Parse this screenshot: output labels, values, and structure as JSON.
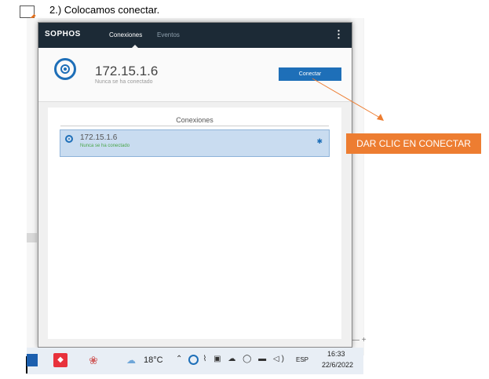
{
  "doc": {
    "step_text": "2.)  Colocamos conectar."
  },
  "sophos": {
    "logo": "SOPHOS",
    "tabs": [
      "Conexiones",
      "Eventos"
    ],
    "menu_icon": "kebab-menu-icon",
    "header_ip": "172.15.1.6",
    "header_status": "Nunca se ha conectado",
    "connect_button": "Conectar",
    "panel_title": "Conexiones",
    "connection": {
      "ip": "172.15.1.6",
      "status": "Nunca se ha conectado",
      "gear_icon": "gear-icon"
    },
    "accent": "#1e6fb8",
    "topbar_color": "#1c2a36"
  },
  "annotation": {
    "label": "DAR CLIC EN CONECTAR",
    "color": "#ed7d31"
  },
  "taskbar": {
    "temperature": "18°C",
    "language": "ESP",
    "time": "16:33",
    "date": "22/6/2022"
  }
}
